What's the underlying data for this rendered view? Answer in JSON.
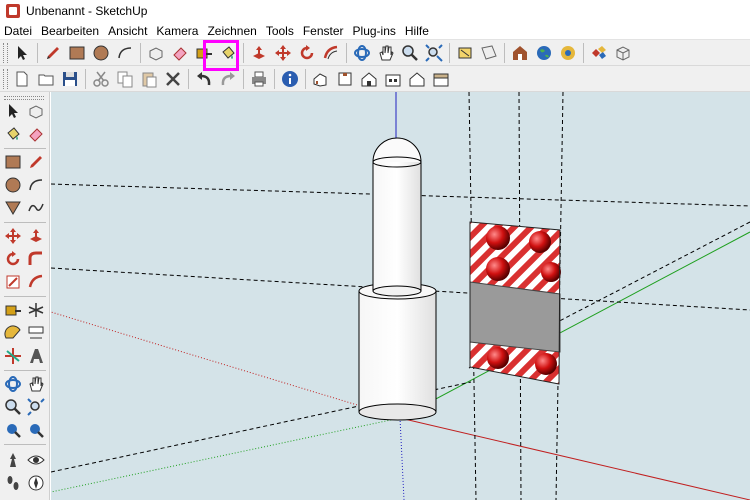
{
  "window": {
    "title": "Unbenannt - SketchUp"
  },
  "menu": [
    "Datei",
    "Bearbeiten",
    "Ansicht",
    "Kamera",
    "Zeichnen",
    "Tools",
    "Fenster",
    "Plug-ins",
    "Hilfe"
  ],
  "toolbar1": [
    {
      "name": "select-tool-button",
      "icon": "arrow-icon"
    },
    {
      "name": "pencil-tool-button",
      "icon": "pencil-icon"
    },
    {
      "name": "rectangle-tool-button",
      "icon": "rectangle-icon"
    },
    {
      "name": "circle-tool-button",
      "icon": "circle-icon"
    },
    {
      "name": "arc-tool-button",
      "icon": "arc-icon"
    },
    {
      "name": "make-component-button",
      "icon": "component-icon"
    },
    {
      "name": "eraser-tool-button",
      "icon": "eraser-icon"
    },
    {
      "name": "tape-measure-button",
      "icon": "tape-icon"
    },
    {
      "name": "paint-bucket-button",
      "icon": "paint-bucket-icon"
    },
    {
      "name": "push-pull-button",
      "icon": "push-pull-icon"
    },
    {
      "name": "move-tool-button",
      "icon": "move-icon"
    },
    {
      "name": "rotate-tool-button",
      "icon": "rotate-icon"
    },
    {
      "name": "offset-tool-button",
      "icon": "offset-icon"
    },
    {
      "name": "orbit-tool-button",
      "icon": "orbit-icon"
    },
    {
      "name": "pan-tool-button",
      "icon": "hand-icon"
    },
    {
      "name": "zoom-tool-button",
      "icon": "zoom-icon"
    },
    {
      "name": "zoom-extents-button",
      "icon": "zoom-extents-icon"
    },
    {
      "name": "previous-view-button",
      "icon": "section-icon"
    },
    {
      "name": "next-view-button",
      "icon": "section-plane-icon"
    },
    {
      "name": "warehouse-button",
      "icon": "warehouse-icon"
    },
    {
      "name": "google-earth-button",
      "icon": "globe-icon"
    },
    {
      "name": "geo-location-button",
      "icon": "location-icon"
    },
    {
      "name": "share-model-button",
      "icon": "share-icon"
    },
    {
      "name": "extension-button",
      "icon": "box-icon"
    }
  ],
  "toolbar2": [
    {
      "name": "new-file-button",
      "icon": "new-file-icon"
    },
    {
      "name": "open-file-button",
      "icon": "folder-icon"
    },
    {
      "name": "save-file-button",
      "icon": "floppy-icon"
    },
    {
      "name": "cut-button",
      "icon": "scissors-icon"
    },
    {
      "name": "copy-button",
      "icon": "copy-icon"
    },
    {
      "name": "paste-button",
      "icon": "paste-icon"
    },
    {
      "name": "delete-button",
      "icon": "delete-x-icon"
    },
    {
      "name": "undo-button",
      "icon": "undo-icon"
    },
    {
      "name": "redo-button",
      "icon": "redo-icon"
    },
    {
      "name": "print-button",
      "icon": "printer-icon"
    },
    {
      "name": "model-info-button",
      "icon": "info-icon"
    },
    {
      "name": "iso-view-button",
      "icon": "house-iso-icon"
    },
    {
      "name": "top-view-button",
      "icon": "house-top-icon"
    },
    {
      "name": "front-view-button",
      "icon": "house-front-icon"
    },
    {
      "name": "right-view-button",
      "icon": "house-right-icon"
    },
    {
      "name": "back-view-button",
      "icon": "house-back-icon"
    },
    {
      "name": "left-view-button",
      "icon": "house-left-icon"
    }
  ],
  "colors": {
    "highlight": "#ff00ff",
    "viewport_background": "#d4e3e8",
    "axis_red": "#c02020",
    "axis_green": "#20a020",
    "axis_blue": "#2020c0"
  }
}
